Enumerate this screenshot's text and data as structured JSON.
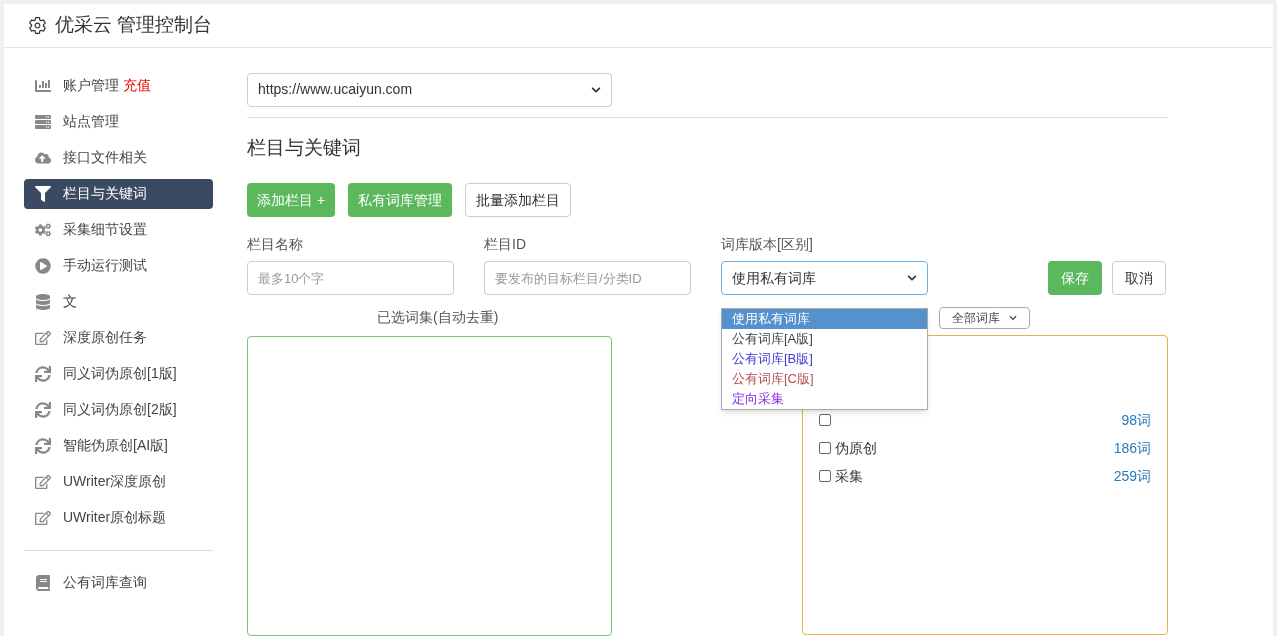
{
  "header": {
    "title": "优采云 管理控制台"
  },
  "sidebar": {
    "items": [
      {
        "label": "账户管理",
        "badge": "充值",
        "selected": false
      },
      {
        "label": "站点管理",
        "selected": false
      },
      {
        "label": "接口文件相关",
        "selected": false
      },
      {
        "label": "栏目与关键词",
        "selected": true
      },
      {
        "label": "采集细节设置",
        "selected": false
      },
      {
        "label": "手动运行测试",
        "selected": false
      },
      {
        "label": "文",
        "selected": false
      },
      {
        "label": "深度原创任务",
        "selected": false
      },
      {
        "label": "同义词伪原创[1版]",
        "selected": false
      },
      {
        "label": "同义词伪原创[2版]",
        "selected": false
      },
      {
        "label": "智能伪原创[AI版]",
        "selected": false
      },
      {
        "label": "UWriter深度原创",
        "selected": false
      },
      {
        "label": "UWriter原创标题",
        "selected": false
      },
      {
        "label": "公有词库查询",
        "selected": false
      }
    ]
  },
  "site_select": {
    "value": "https://www.ucaiyun.com"
  },
  "section_title": "栏目与关键词",
  "toolbar": [
    {
      "label": "添加栏目 +",
      "kind": "primary"
    },
    {
      "label": "私有词库管理",
      "kind": "primary"
    },
    {
      "label": "批量添加栏目",
      "kind": "default"
    }
  ],
  "form": {
    "name": {
      "label": "栏目名称",
      "placeholder": "最多10个字"
    },
    "id": {
      "label": "栏目ID",
      "placeholder": "要发布的目标栏目/分类ID"
    },
    "library": {
      "label": "词库版本[区别]",
      "value": "使用私有词库",
      "options": [
        {
          "label": "使用私有词库",
          "selected": true
        },
        {
          "label": "公有词库[A版]",
          "selected": false
        },
        {
          "label": "公有词库[B版]",
          "selected": false,
          "color": "#3b3bd6"
        },
        {
          "label": "公有词库[C版]",
          "selected": false,
          "color": "#b05050"
        },
        {
          "label": "定向采集",
          "selected": false,
          "color": "#8a2be2"
        }
      ]
    },
    "save": "保存",
    "cancel": "取消"
  },
  "selected_label": "已选词集(自动去重)",
  "filter_select": {
    "value": "全部词库"
  },
  "word_sets": [
    {
      "count": "98词",
      "checked": false
    },
    {
      "label": "伪原创",
      "count": "186词",
      "checked": false
    },
    {
      "label": "采集",
      "count": "259词",
      "checked": false
    }
  ]
}
